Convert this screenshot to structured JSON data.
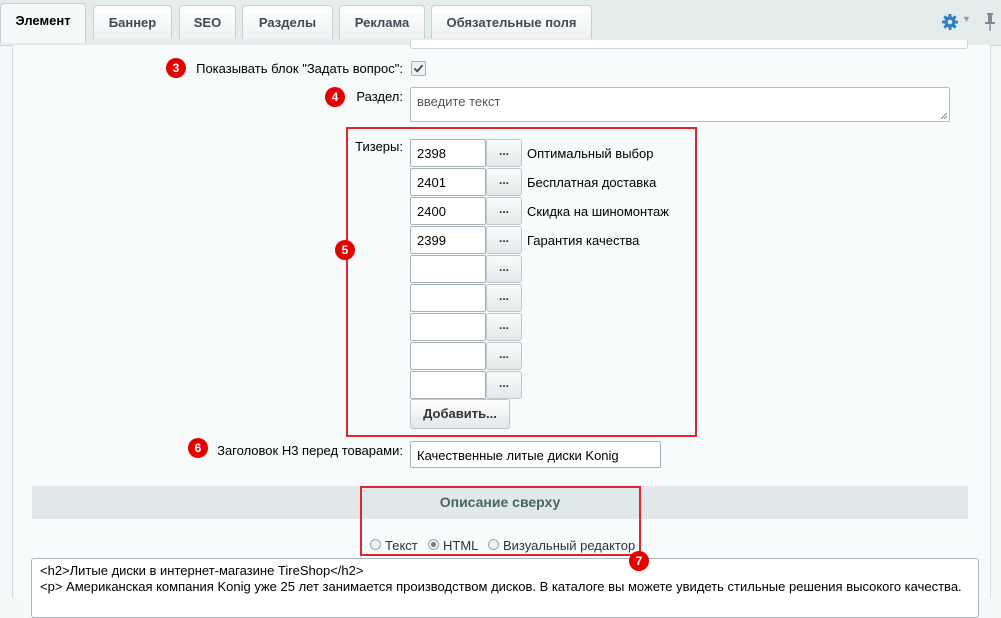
{
  "tabs": [
    {
      "label": "Элемент"
    },
    {
      "label": "Баннер"
    },
    {
      "label": "SEO"
    },
    {
      "label": "Разделы"
    },
    {
      "label": "Реклама"
    },
    {
      "label": "Обязательные поля"
    }
  ],
  "active_tab": "Элемент",
  "badges": [
    "3",
    "4",
    "5",
    "6",
    "7"
  ],
  "fields": {
    "show_question_label": "Показывать блок \"Задать вопрос\":",
    "show_question_checked": true,
    "section_label": "Раздел:",
    "section_value": "введите текст",
    "teasers_label": "Тизеры:",
    "teasers": [
      {
        "id": "2398",
        "name": "Оптимальный выбор"
      },
      {
        "id": "2401",
        "name": "Бесплатная доставка"
      },
      {
        "id": "2400",
        "name": "Скидка на шиномонтаж"
      },
      {
        "id": "2399",
        "name": "Гарантия качества"
      },
      {
        "id": "",
        "name": ""
      },
      {
        "id": "",
        "name": ""
      },
      {
        "id": "",
        "name": ""
      },
      {
        "id": "",
        "name": ""
      },
      {
        "id": "",
        "name": ""
      }
    ],
    "browse_label": "...",
    "add_button": "Добавить...",
    "h3_label": "Заголовок H3 перед товарами:",
    "h3_value": "Качественные литые диски Konig"
  },
  "description": {
    "title": "Описание сверху",
    "modes": [
      "Текст",
      "HTML",
      "Визуальный редактор"
    ],
    "selected_mode": "HTML",
    "content_lines": [
      "<h2>Литые диски в интернет-магазине TireShop</h2>",
      "<p> Американская компания Konig уже 25 лет занимается производством дисков. В каталоге вы можете увидеть стильные решения высокого качества."
    ]
  },
  "colors": {
    "highlight": "#e0262c",
    "badge": "#e60000",
    "gear": "#2f7fc9"
  },
  "icons": [
    "gear-icon",
    "pin-icon",
    "checkmark-icon"
  ]
}
